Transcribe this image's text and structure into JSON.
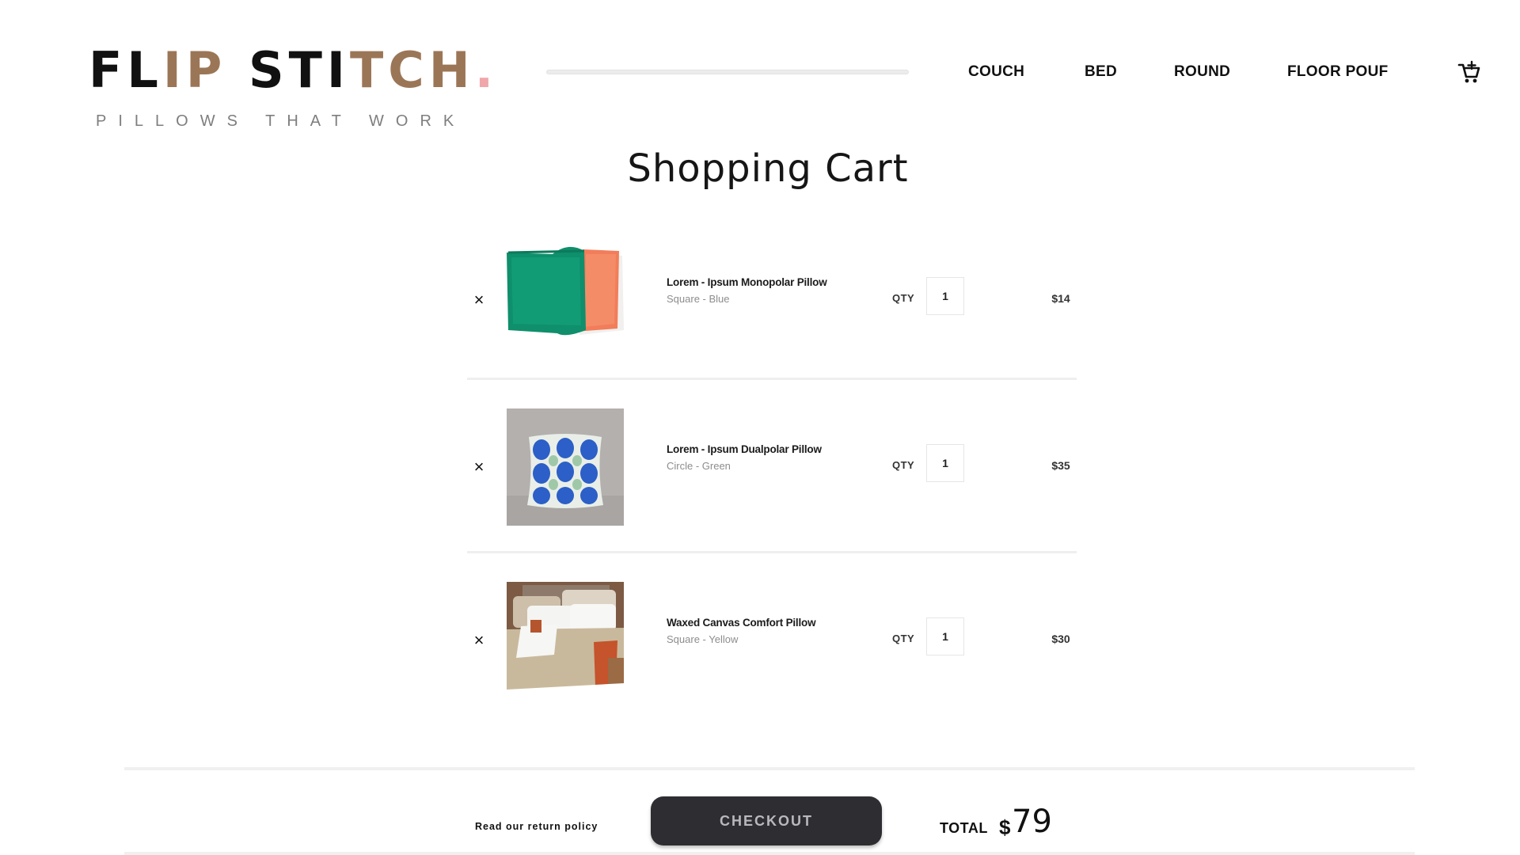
{
  "brand": {
    "logo_parts": [
      "FL",
      "IP",
      " ST",
      "I",
      "T",
      "CH",
      "."
    ],
    "tagline": "PILLOWS THAT WORK"
  },
  "nav": {
    "links": [
      "COUCH",
      "BED",
      "ROUND",
      "FLOOR POUF"
    ],
    "cart_icon": "cart-add-icon"
  },
  "page": {
    "title": "Shopping Cart"
  },
  "cart": {
    "qty_label": "QTY",
    "items": [
      {
        "name": "Lorem - Ipsum Monopolar Pillow",
        "variant": "Square - Blue",
        "qty": "1",
        "price": "$14",
        "image": "green-and-orange-pillows"
      },
      {
        "name": "Lorem - Ipsum Dualpolar Pillow",
        "variant": "Circle - Green",
        "qty": "1",
        "price": "$35",
        "image": "blue-pattern-pillow"
      },
      {
        "name": "Waxed Canvas Comfort Pillow",
        "variant": "Square - Yellow",
        "qty": "1",
        "price": "$30",
        "image": "bedroom-pillows"
      }
    ]
  },
  "footer": {
    "return_policy": "Read our return policy",
    "checkout_label": "CHECKOUT",
    "total_label": "TOTAL",
    "total_currency": "$",
    "total_amount": "79"
  },
  "colors": {
    "accent_brown": "#9b7656",
    "logo_dot_pink": "#f0a7aa",
    "checkout_bg": "#2e2e32"
  }
}
